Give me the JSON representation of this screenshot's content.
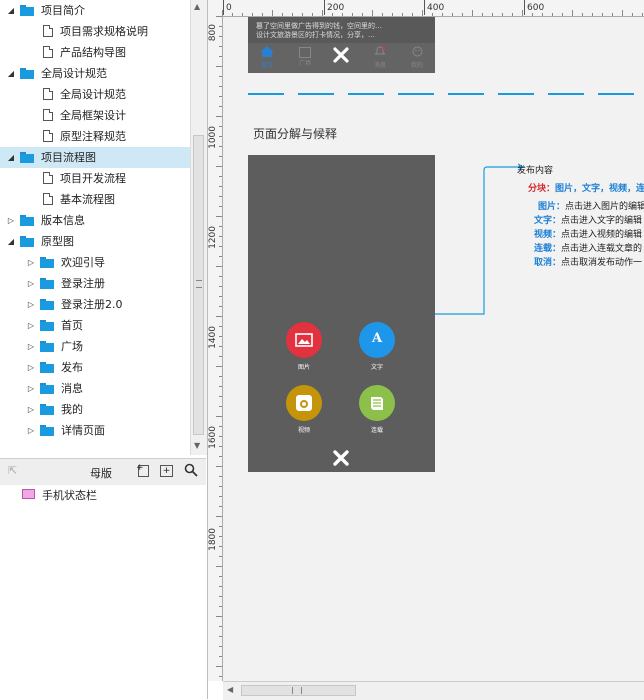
{
  "tree": {
    "items": [
      {
        "label": "项目简介",
        "type": "folder",
        "level": 0,
        "expanded": true
      },
      {
        "label": "项目需求规格说明",
        "type": "page",
        "level": 1
      },
      {
        "label": "产品结构导图",
        "type": "page",
        "level": 1
      },
      {
        "label": "全局设计规范",
        "type": "folder",
        "level": 0,
        "expanded": true
      },
      {
        "label": "全局设计规范",
        "type": "page",
        "level": 1
      },
      {
        "label": "全局框架设计",
        "type": "page",
        "level": 1
      },
      {
        "label": "原型注释规范",
        "type": "page",
        "level": 1
      },
      {
        "label": "项目流程图",
        "type": "folder",
        "level": 0,
        "expanded": true,
        "selected": true
      },
      {
        "label": "项目开发流程",
        "type": "page",
        "level": 1
      },
      {
        "label": "基本流程图",
        "type": "page",
        "level": 1
      },
      {
        "label": "版本信息",
        "type": "folder",
        "level": 0,
        "expanded": false
      },
      {
        "label": "原型图",
        "type": "folder",
        "level": 0,
        "expanded": true
      },
      {
        "label": "欢迎引导",
        "type": "folder",
        "level": 1,
        "expanded": false
      },
      {
        "label": "登录注册",
        "type": "folder",
        "level": 1,
        "expanded": false
      },
      {
        "label": "登录注册2.0",
        "type": "folder",
        "level": 1,
        "expanded": false
      },
      {
        "label": "首页",
        "type": "folder",
        "level": 1,
        "expanded": false
      },
      {
        "label": "广场",
        "type": "folder",
        "level": 1,
        "expanded": false
      },
      {
        "label": "发布",
        "type": "folder",
        "level": 1,
        "expanded": false
      },
      {
        "label": "消息",
        "type": "folder",
        "level": 1,
        "expanded": false
      },
      {
        "label": "我的",
        "type": "folder",
        "level": 1,
        "expanded": false
      },
      {
        "label": "详情页面",
        "type": "folder",
        "level": 1,
        "expanded": false
      }
    ]
  },
  "masters": {
    "title": "母版",
    "items": [
      {
        "label": "手机状态栏"
      }
    ]
  },
  "rulers": {
    "h_ticks": [
      "0",
      "200",
      "400",
      "600"
    ],
    "v_ticks": [
      "800",
      "1000",
      "1200",
      "1400",
      "1600",
      "1800"
    ]
  },
  "canvas": {
    "top_frame": {
      "text_line1": "篡了空间里做广告得到的钱，空间里的…",
      "text_line2": "设计文旅游景区的打卡情况，分享，…",
      "tabs": [
        {
          "label": "首页",
          "icon": "home-icon"
        },
        {
          "label": "广场",
          "icon": "square-icon"
        },
        {
          "label": "",
          "icon": "close-icon"
        },
        {
          "label": "消息",
          "icon": "bell-icon"
        },
        {
          "label": "我的",
          "icon": "user-icon"
        }
      ]
    },
    "section_title": "页面分解与候释",
    "publish_popup": {
      "items": [
        {
          "label": "图片",
          "icon": "image-icon",
          "color": "#e2313f"
        },
        {
          "label": "文字",
          "icon": "text-icon",
          "color": "#1e96ea"
        },
        {
          "label": "视频",
          "icon": "camera-icon",
          "color": "#c4940b"
        },
        {
          "label": "连载",
          "icon": "book-icon",
          "color": "#8cc04a"
        }
      ]
    },
    "annotation": {
      "title": "发布内容",
      "category_prefix": "分块：",
      "category_values": "图片，文字，视频，连",
      "details": [
        {
          "key": "图片：",
          "text": "点击进入图片的编辑"
        },
        {
          "key": "文字：",
          "text": "点击进入文字的编辑"
        },
        {
          "key": "视频：",
          "text": "点击进入视频的编辑"
        },
        {
          "key": "连载：",
          "text": "点击进入连载文章的"
        },
        {
          "key": "取消：",
          "text": "点击取消发布动作一"
        }
      ]
    }
  },
  "colors": {
    "selection": "#cfe8f6",
    "accent": "#1a9be0",
    "canvas_bg": "#f2f2f2",
    "frame": "#595959"
  }
}
